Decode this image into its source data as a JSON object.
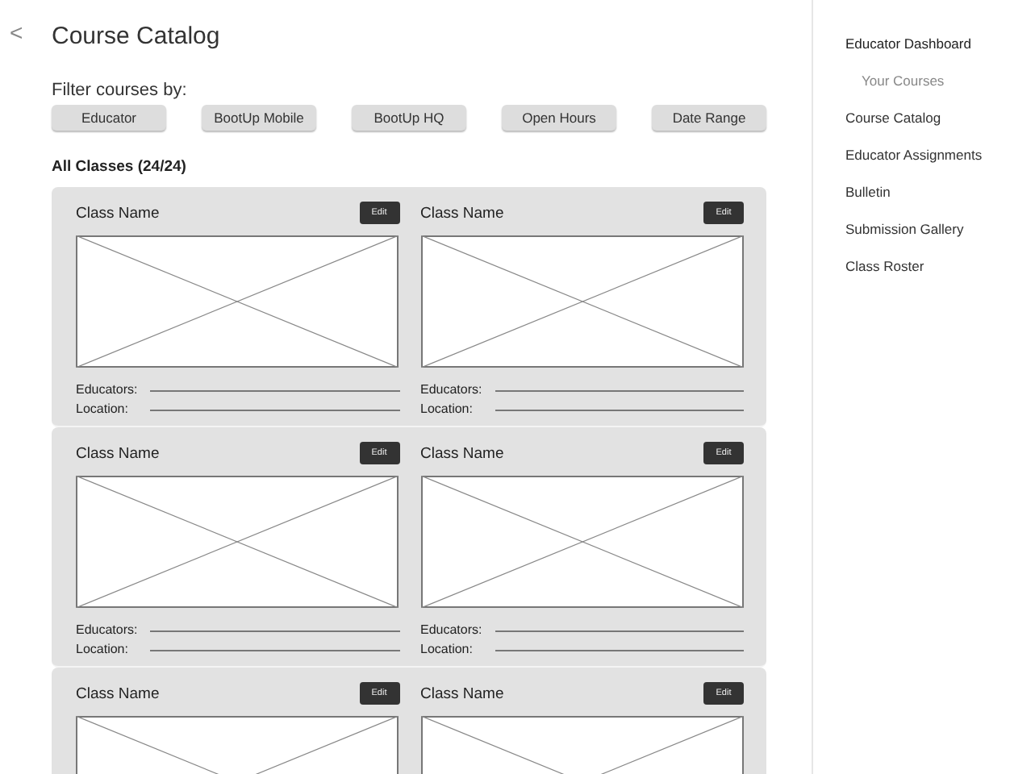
{
  "header": {
    "back": "<",
    "title": "Course Catalog"
  },
  "filters": {
    "label": "Filter courses by:",
    "buttons": [
      "Educator",
      "BootUp Mobile",
      "BootUp HQ",
      "Open Hours",
      "Date Range"
    ]
  },
  "classes": {
    "heading": "All Classes (24/24)",
    "rows": [
      {
        "cards": [
          {
            "name": "Class Name",
            "edit": "Edit",
            "fields": [
              "Educators:",
              "Location:"
            ]
          },
          {
            "name": "Class Name",
            "edit": "Edit",
            "fields": [
              "Educators:",
              "Location:"
            ]
          }
        ]
      },
      {
        "cards": [
          {
            "name": "Class Name",
            "edit": "Edit",
            "fields": [
              "Educators:",
              "Location:"
            ]
          },
          {
            "name": "Class Name",
            "edit": "Edit",
            "fields": [
              "Educators:",
              "Location:"
            ]
          }
        ]
      },
      {
        "cards": [
          {
            "name": "Class Name",
            "edit": "Edit"
          },
          {
            "name": "Class Name",
            "edit": "Edit"
          }
        ]
      }
    ]
  },
  "sidebar": {
    "items": [
      {
        "label": "Educator Dashboard",
        "children": [
          {
            "label": "Your Courses"
          }
        ]
      },
      {
        "label": "Course Catalog"
      },
      {
        "label": "Educator Assignments"
      },
      {
        "label": "Bulletin"
      },
      {
        "label": "Submission Gallery"
      },
      {
        "label": "Class Roster"
      }
    ]
  }
}
